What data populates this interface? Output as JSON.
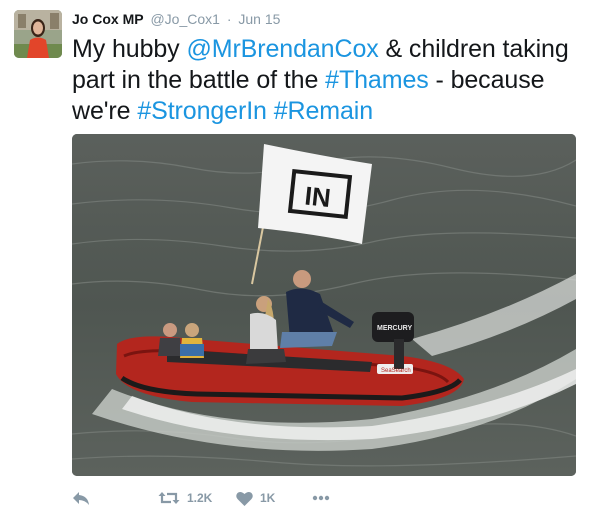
{
  "tweet": {
    "author_name": "Jo Cox MP",
    "author_handle": "@Jo_Cox1",
    "separator": "·",
    "timestamp": "Jun 15",
    "text_segments": [
      {
        "t": "My hubby ",
        "link": false
      },
      {
        "t": "@MrBrendanCox",
        "link": true
      },
      {
        "t": " & children taking part in the battle of the ",
        "link": false
      },
      {
        "t": "#Thames",
        "link": true
      },
      {
        "t": " - because we're ",
        "link": false
      },
      {
        "t": "#StrongerIn",
        "link": true
      },
      {
        "t": " ",
        "link": false
      },
      {
        "t": "#Remain",
        "link": true
      }
    ],
    "flag_text": "IN",
    "outboard_brand": "MERCURY",
    "boat_brand": "SeaSearch"
  },
  "actions": {
    "reply": {
      "icon": "reply-icon"
    },
    "retweet": {
      "icon": "retweet-icon",
      "count": "1.2K"
    },
    "like": {
      "icon": "heart-icon",
      "count": "1K"
    },
    "more": {
      "icon": "more-icon"
    }
  },
  "colors": {
    "link": "#1b95e0",
    "meta": "#8899a6",
    "text": "#14171a"
  }
}
